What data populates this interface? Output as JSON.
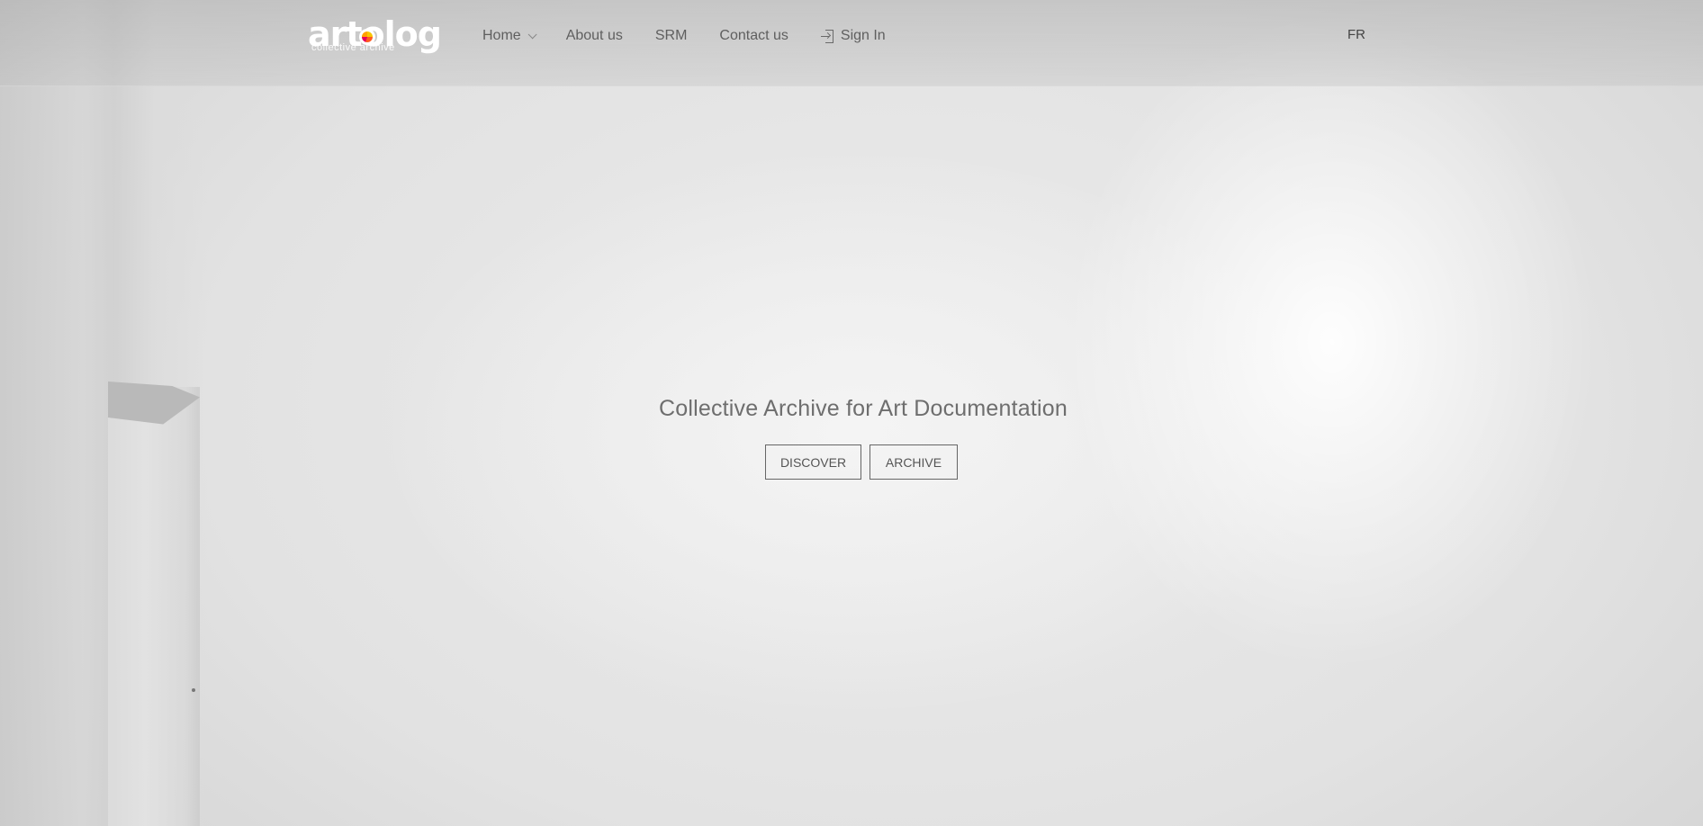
{
  "header": {
    "logo": {
      "wordmark": "artolog",
      "tagline": "collective archive"
    },
    "nav": [
      {
        "label": "Home",
        "has_dropdown": true,
        "icon": "chevron-down-icon"
      },
      {
        "label": "About us"
      },
      {
        "label": "SRM"
      },
      {
        "label": "Contact us"
      },
      {
        "label": "Sign In",
        "icon": "sign-in-icon"
      }
    ],
    "language": "FR"
  },
  "hero": {
    "title": "Collective Archive for Art Documentation",
    "buttons": {
      "discover": "DISCOVER",
      "archive": "ARCHIVE"
    }
  },
  "colors": {
    "nav_text": "#5f5f5f",
    "hero_text": "#6e6e6e",
    "button_border": "#666666",
    "logo_accent": "#ff5a1f"
  }
}
